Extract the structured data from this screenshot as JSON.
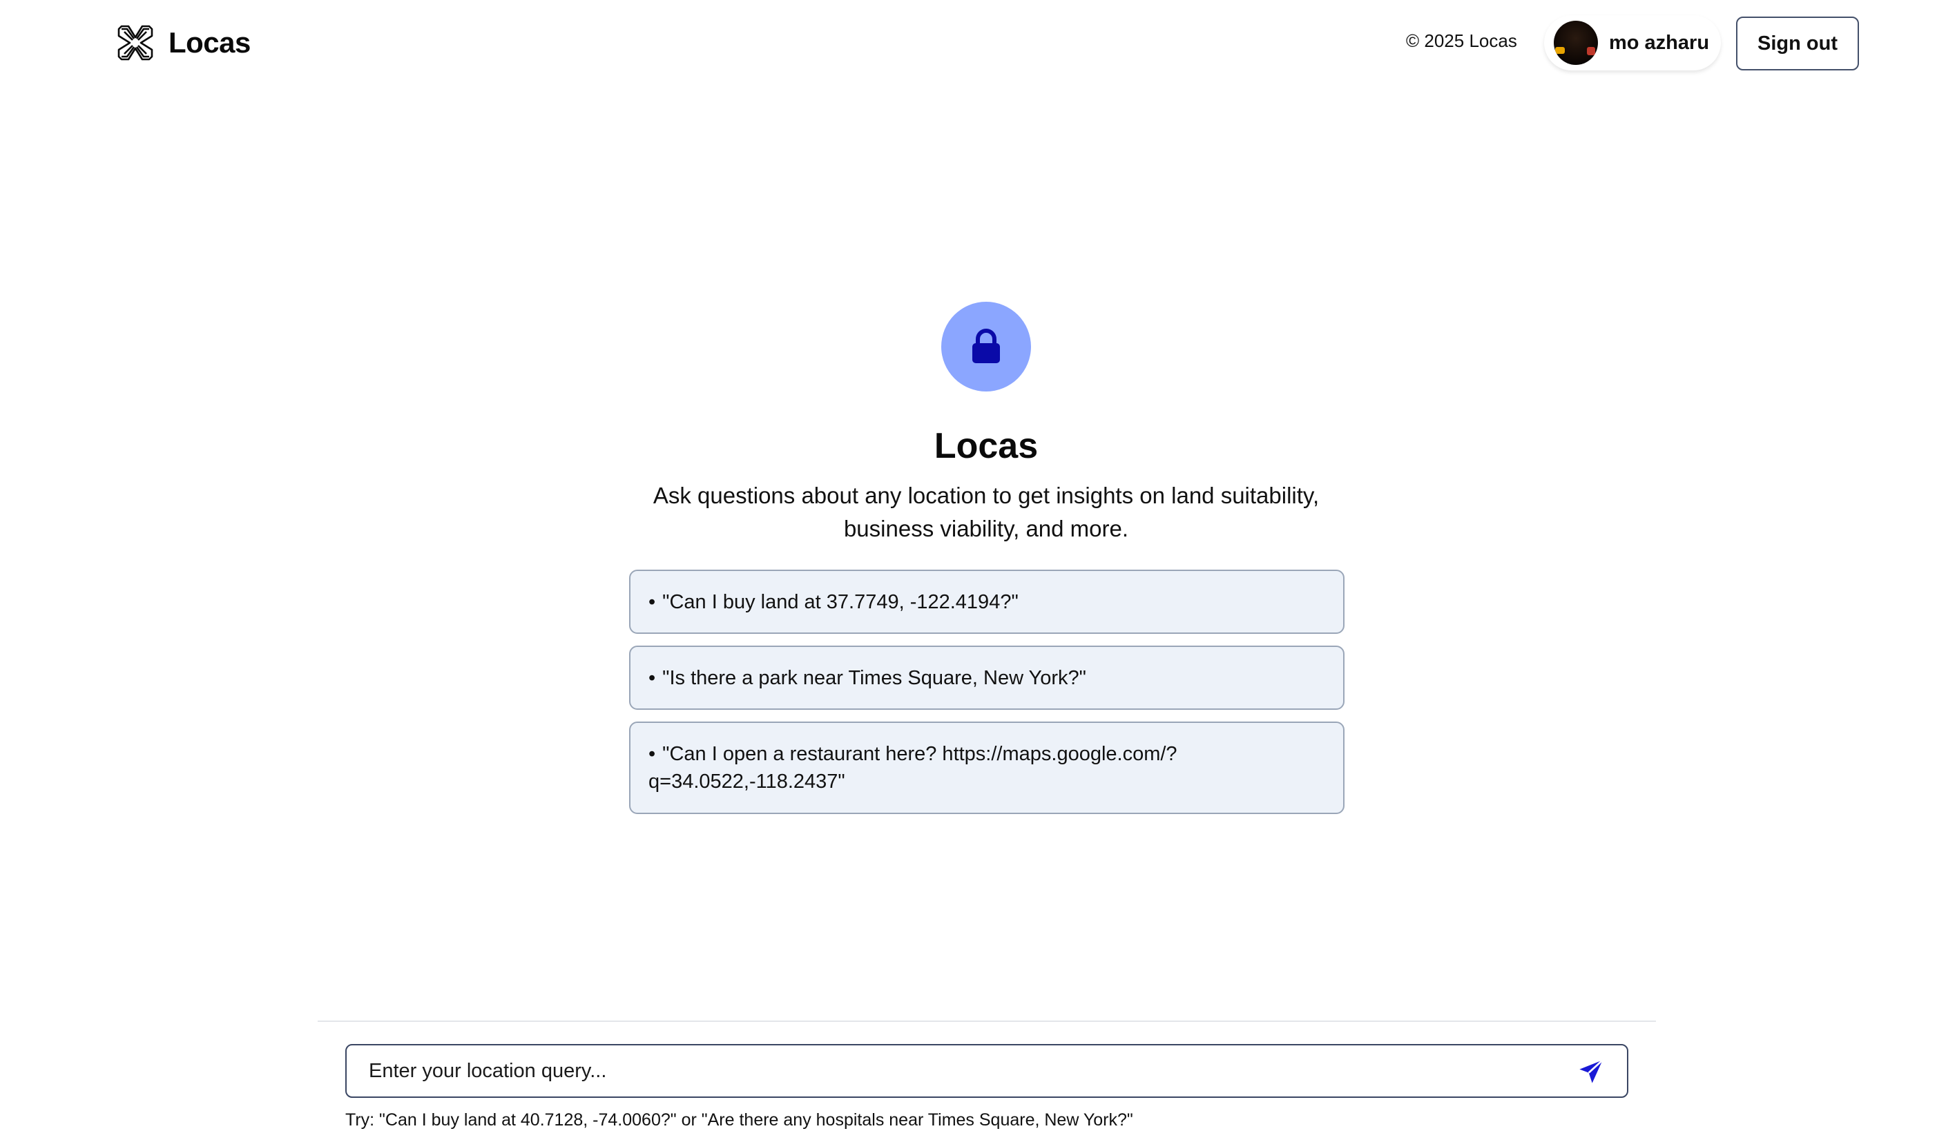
{
  "header": {
    "brand_name": "Locas",
    "copyright": "© 2025 Locas",
    "user_name": "mo azharu",
    "signout_label": "Sign out"
  },
  "hero": {
    "icon": "lock-icon",
    "title": "Locas",
    "subtitle_line1": "Ask questions about any location to get insights on land suitability,",
    "subtitle_line2": "business viability, and more."
  },
  "examples": [
    {
      "bullet": "•",
      "text": "\"Can I buy land at 37.7749, -122.4194?\""
    },
    {
      "bullet": "•",
      "text": "\"Is there a park near Times Square, New York?\""
    },
    {
      "bullet": "•",
      "text": "\"Can I open a restaurant here? https://maps.google.com/?q=34.0522,-118.2437\""
    }
  ],
  "query": {
    "placeholder": "Enter your location query...",
    "value": "",
    "send_icon": "send-icon",
    "hint": "Try: \"Can I buy land at 40.7128, -74.0060?\" or \"Are there any hospitals near Times Square, New York?\""
  },
  "colors": {
    "accent": "#1a1ad6",
    "icon_circle": "#8ba6ff",
    "lock": "#0a0aa8",
    "example_bg": "#edf2f9",
    "example_border": "#9aa6b8"
  }
}
